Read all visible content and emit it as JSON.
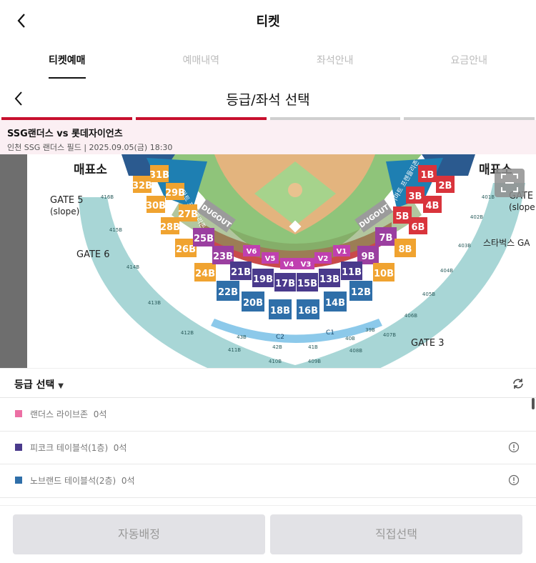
{
  "header": {
    "title": "티켓",
    "back_icon": "chevron-left-icon"
  },
  "tabs": [
    {
      "label": "티켓예매",
      "active": true
    },
    {
      "label": "예매내역",
      "active": false
    },
    {
      "label": "좌석안내",
      "active": false
    },
    {
      "label": "요금안내",
      "active": false
    }
  ],
  "step": {
    "title": "등급/좌석 선택",
    "progress_done": 2,
    "progress_total": 4
  },
  "event": {
    "name": "SSG랜더스 vs 롯데자이언츠",
    "meta": "인천 SSG 랜더스 필드 | 2025.09.05(금) 18:30"
  },
  "map": {
    "labels": {
      "gate5": "GATE 5",
      "gate5_sub": "(slope)",
      "gate6": "GATE 6",
      "gate3": "GATE 3",
      "gate4": "GATE",
      "gate4_sub": "(slope",
      "starbucks": "스타벅스 GA",
      "ticket_left": "매표소",
      "ticket_right": "매표소",
      "dugout_left": "DUGOUT",
      "dugout_right": "DUGOUT",
      "emart_left": "이마트 프렌들리존",
      "emart_right": "이마트 프렌들리존"
    },
    "sections": {
      "orange_left": [
        "31B",
        "29B",
        "27B",
        "32B",
        "30B",
        "28B",
        "26B",
        "24B"
      ],
      "purple_left": [
        "25B",
        "23B"
      ],
      "red_right": [
        "1B",
        "3B",
        "5B",
        "2B",
        "4B",
        "6B"
      ],
      "purple_right": [
        "7B",
        "9B"
      ],
      "orange_right": [
        "8B",
        "10B"
      ],
      "v_row": [
        "V6",
        "V5",
        "V4",
        "V3",
        "V2",
        "V1"
      ],
      "purple_inner": [
        "21B",
        "19B",
        "17B",
        "15B",
        "13B",
        "11B"
      ],
      "blue_outer": [
        "22B",
        "20B",
        "18B",
        "16B",
        "14B",
        "12B"
      ],
      "ring_c": [
        "C2",
        "C1"
      ],
      "outer_bottom": [
        "411B",
        "410B",
        "409B",
        "408B"
      ],
      "outer_left": [
        "416B",
        "415B",
        "414B",
        "413B",
        "412B"
      ],
      "outer_right": [
        "401B",
        "402B",
        "403B",
        "404B",
        "405B",
        "406B",
        "407B"
      ],
      "ring_42": [
        "42B",
        "41B",
        "40B",
        "39B",
        "43B"
      ]
    },
    "zoom_icon": "fullscreen-icon"
  },
  "grade": {
    "header_label": "등급 선택",
    "caret_icon": "caret-down-icon",
    "refresh_icon": "refresh-icon",
    "rows": [
      {
        "name": "랜더스 라이브존",
        "count": "0석",
        "color": "#ec6fa4",
        "info": false
      },
      {
        "name": "피코크 테이블석(1층)",
        "count": "0석",
        "color": "#4a3a8c",
        "info": true
      },
      {
        "name": "노브랜드 테이블석(2층)",
        "count": "0석",
        "color": "#2f6fa9",
        "info": true
      }
    ]
  },
  "buttons": {
    "auto": "자동배정",
    "direct": "직접선택"
  }
}
